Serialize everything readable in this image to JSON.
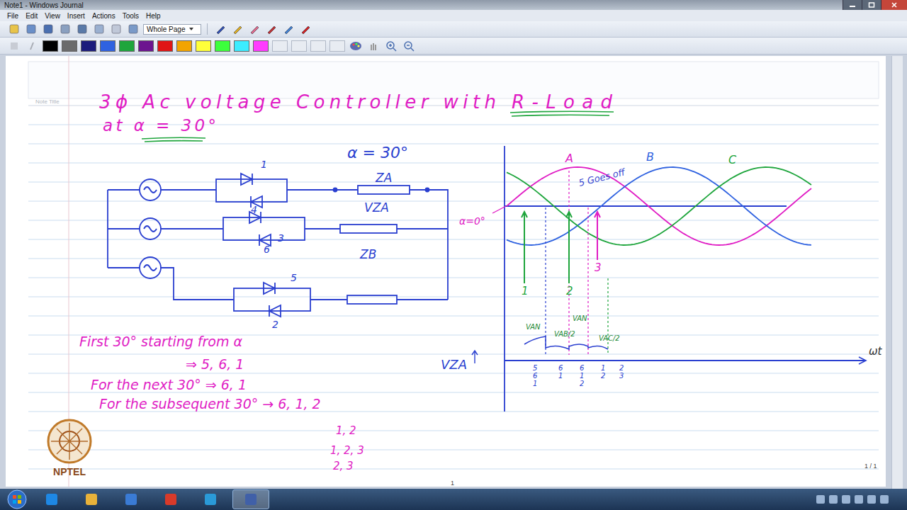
{
  "window": {
    "title": "Note1 - Windows Journal"
  },
  "menu": [
    "File",
    "Edit",
    "View",
    "Insert",
    "Actions",
    "Tools",
    "Help"
  ],
  "toolbar": {
    "view": "Whole Page"
  },
  "palette": [
    {
      "color": "#000000"
    },
    {
      "color": "#6b6b6b"
    },
    {
      "color": "#1c1c7c"
    },
    {
      "color": "#2f62e0"
    },
    {
      "color": "#1ea53c"
    },
    {
      "color": "#6c148f"
    },
    {
      "color": "#e01515"
    },
    {
      "color": "#f2a400"
    },
    {
      "color": "#ffff3a"
    },
    {
      "color": "#3cff3c"
    },
    {
      "color": "#3cecff"
    },
    {
      "color": "#ff3cff"
    }
  ],
  "note": {
    "title_field": "Note Title",
    "heading": "3ϕ Ac voltage Controller with",
    "heading_load": "R-Load",
    "subheading": "at α = 30°"
  },
  "circuit": {
    "alpha": "α = 30°",
    "thyristors": [
      {
        "label": "1"
      },
      {
        "label": "4"
      },
      {
        "label": "3"
      },
      {
        "label": "6"
      },
      {
        "label": "5"
      },
      {
        "label": "2"
      }
    ],
    "loads": [
      "ZA",
      "ZB"
    ],
    "load_voltage": "VZA"
  },
  "waveforms": {
    "alpha_zero": "α=0°",
    "goes_off": "5 Goes off",
    "phases": [
      {
        "label": "A",
        "color": "#e01cc4",
        "phase_deg": 0
      },
      {
        "label": "B",
        "color": "#2f62e0",
        "phase_deg": 120
      },
      {
        "label": "C",
        "color": "#1ea53c",
        "phase_deg": 240
      }
    ],
    "pulses": [
      {
        "label": "1",
        "color": "#1ea53c"
      },
      {
        "label": "2",
        "color": "#1ea53c"
      },
      {
        "label": "3",
        "color": "#e01cc4"
      }
    ]
  },
  "output": {
    "axis_label": "VZA",
    "time_label": "ωt",
    "segments": [
      {
        "label": "VAN"
      },
      {
        "label": "VAB/2"
      },
      {
        "label": "VAN"
      },
      {
        "label": "VAC/2"
      }
    ],
    "conduction": [
      [
        "5",
        "6",
        "1"
      ],
      [
        "6",
        "1"
      ],
      [
        "6",
        "1",
        "2"
      ],
      [
        "1",
        "2"
      ],
      [
        "2",
        "3"
      ]
    ]
  },
  "notes": [
    "First 30° starting from α",
    "⇒ 5, 6, 1",
    "For the next 30° ⇒ 6, 1",
    "For the subsequent 30° → 6, 1, 2"
  ],
  "sequence": [
    "1, 2",
    "1, 2, 3",
    "2, 3"
  ],
  "logo": "NPTEL",
  "page": {
    "indicator": "1 / 1",
    "number": "1"
  }
}
